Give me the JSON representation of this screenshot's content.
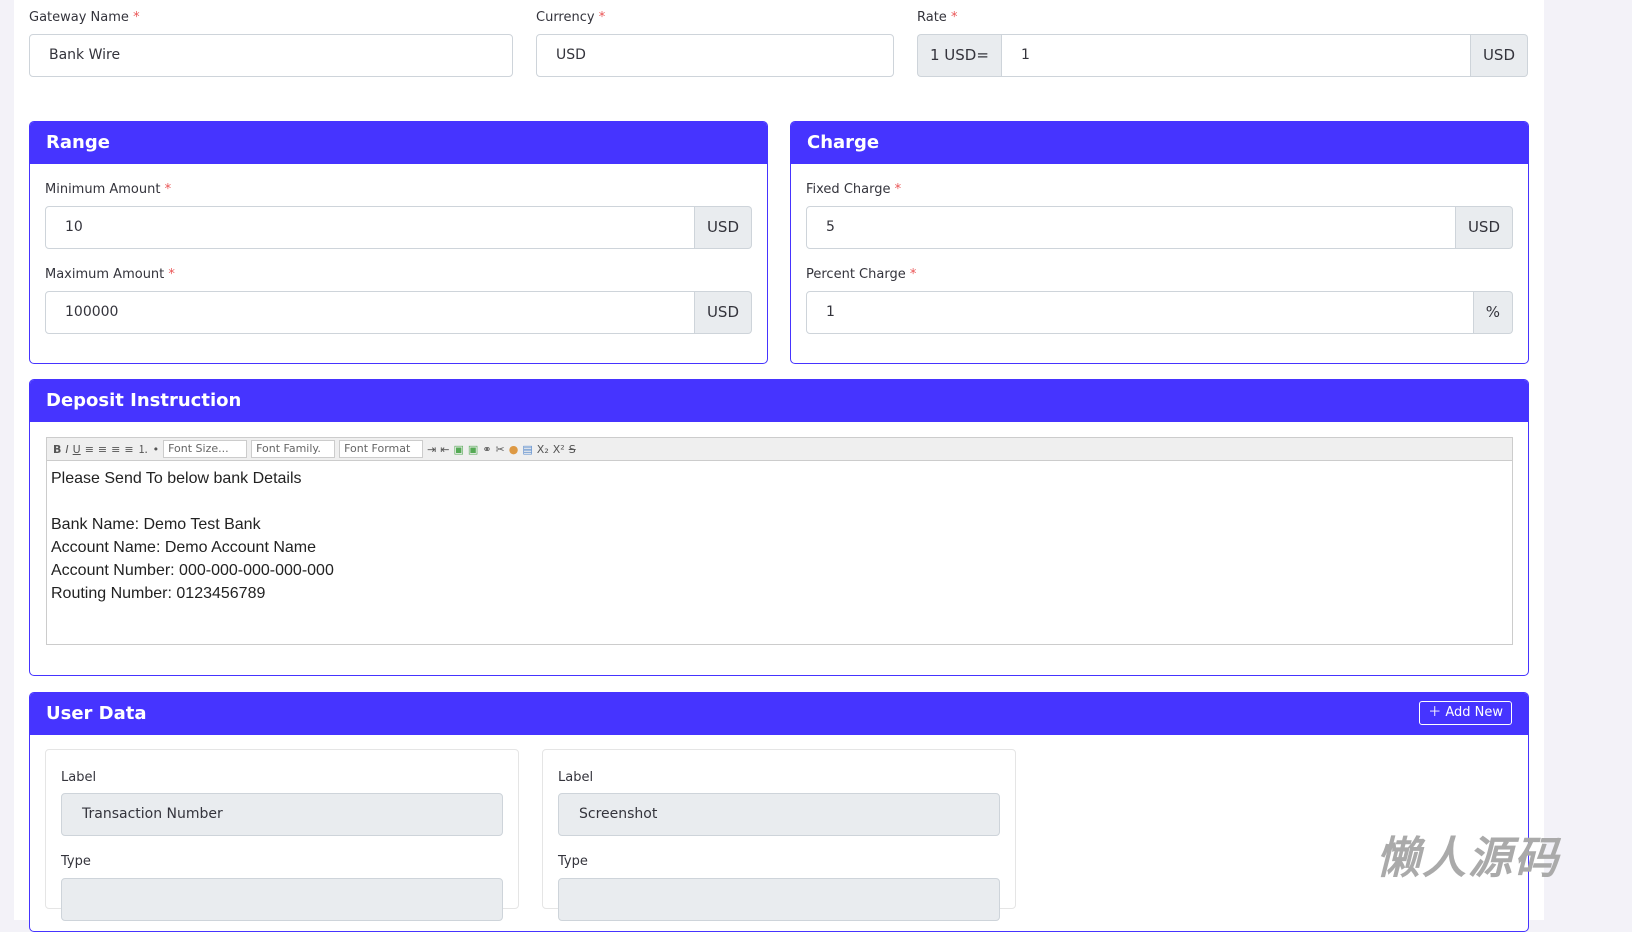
{
  "gateway": {
    "label": "Gateway Name",
    "value": "Bank Wire"
  },
  "currency": {
    "label": "Currency",
    "value": "USD"
  },
  "rate": {
    "label": "Rate",
    "prefix": "1 USD=",
    "value": "1",
    "suffix": "USD"
  },
  "required": "*",
  "range": {
    "title": "Range",
    "min_label": "Minimum Amount",
    "min_value": "10",
    "max_label": "Maximum Amount",
    "max_value": "100000",
    "unit": "USD"
  },
  "charge": {
    "title": "Charge",
    "fixed_label": "Fixed Charge",
    "fixed_value": "5",
    "fixed_unit": "USD",
    "percent_label": "Percent Charge",
    "percent_value": "1",
    "percent_unit": "%"
  },
  "deposit": {
    "title": "Deposit Instruction",
    "toolbar": {
      "bold": "B",
      "italic": "I",
      "underline": "U",
      "font_size": "Font Size...",
      "font_family": "Font Family.",
      "font_format": "Font Format",
      "sub": "X₂",
      "sup": "X²",
      "strike": "S"
    },
    "content": "Please Send To below bank Details\n\nBank Name: Demo Test Bank\nAccount Name: Demo Account Name\nAccount Number: 000-000-000-000-000\nRouting Number: 0123456789"
  },
  "user_data": {
    "title": "User Data",
    "add_new": "Add New",
    "items": [
      {
        "label_caption": "Label",
        "label_value": "Transaction Number",
        "type_caption": "Type"
      },
      {
        "label_caption": "Label",
        "label_value": "Screenshot",
        "type_caption": "Type"
      }
    ]
  },
  "watermark": "懒人源码"
}
